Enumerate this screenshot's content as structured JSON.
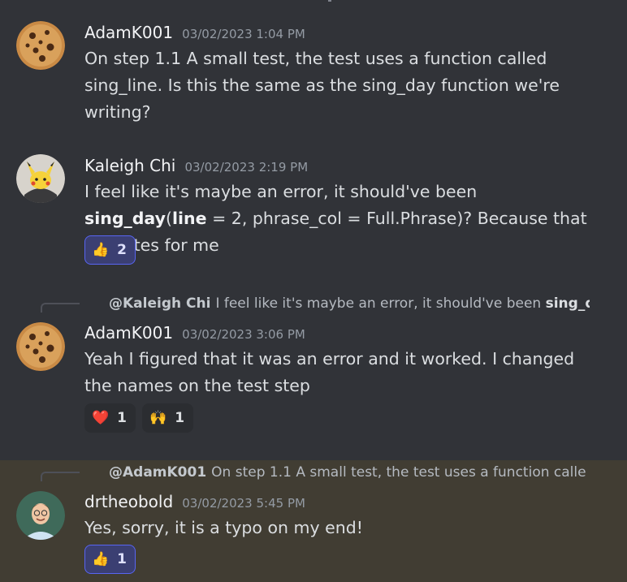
{
  "messages": [
    {
      "author": "AdamK001",
      "timestamp": "03/02/2023 1:04 PM",
      "avatar": "cookie-avatar",
      "text": "On step 1.1 A small test, the test uses a function called sing_line. Is this the same as the sing_day function we're writing?"
    },
    {
      "author": "Kaleigh Chi",
      "timestamp": "03/02/2023 2:19 PM",
      "avatar": "pikachu-avatar",
      "text_parts": [
        "I feel like it's maybe an error, it should've been ",
        "sing_day",
        "(",
        "line",
        " = 2, phrase_col = Full.Phrase)? Because that executes for me"
      ],
      "reactions": [
        {
          "emoji": "👍",
          "count": "2",
          "me": true
        }
      ]
    },
    {
      "author": "AdamK001",
      "timestamp": "03/02/2023 3:06 PM",
      "avatar": "cookie-avatar",
      "reply": {
        "mention": "@Kaleigh Chi",
        "text": "I feel like it's maybe an error, it should've been ",
        "bold_tail": "sing_d"
      },
      "text": "Yeah I figured that it was an error and it worked. I changed the names on the test step",
      "reactions": [
        {
          "emoji": "❤️",
          "count": "1",
          "me": false
        },
        {
          "emoji": "🙌",
          "count": "1",
          "me": false
        }
      ]
    },
    {
      "author": "drtheobold",
      "timestamp": "03/02/2023 5:45 PM",
      "avatar": "person-avatar",
      "reply": {
        "mention": "@AdamK001",
        "text": "On step 1.1 A small test, the test uses a function calle"
      },
      "text": "Yes, sorry, it is a typo on my end!",
      "reactions": [
        {
          "emoji": "👍",
          "count": "1",
          "me": true
        }
      ],
      "highlight_color": "#413d33"
    }
  ]
}
